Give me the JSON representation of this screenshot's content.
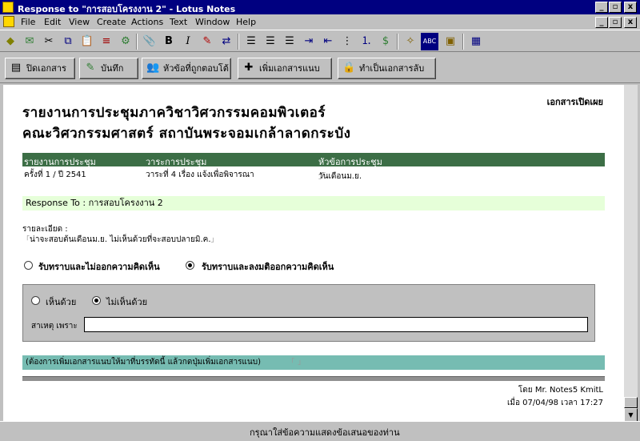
{
  "window": {
    "title": "Response to \"การสอบโครงงาน 2\" - Lotus Notes",
    "controls": [
      "_",
      "▫",
      "x"
    ]
  },
  "menu": [
    "File",
    "Edit",
    "View",
    "Create",
    "Actions",
    "Text",
    "Window",
    "Help"
  ],
  "toolbar_icons": [
    "navigator-icon",
    "mail-icon",
    "cut-icon",
    "copy-icon",
    "paste-icon",
    "stack-icon",
    "properties-icon",
    "attach-icon",
    "bold-icon",
    "italic-icon",
    "highlighter-icon",
    "permanent-pen-icon",
    "align-left-icon",
    "align-center-icon",
    "align-right-icon",
    "indent-icon",
    "outdent-icon",
    "bullets-icon",
    "numbers-icon",
    "text-style-icon",
    "flashlight-icon",
    "spell-check-icon",
    "form-icon",
    "table-icon"
  ],
  "actions": [
    {
      "label": "ปิดเอกสาร",
      "icon": "close-document-icon"
    },
    {
      "label": "บันทึก",
      "icon": "save-icon"
    },
    {
      "label": "หัวข้อที่ถูกตอบโต้",
      "icon": "topic-icon"
    },
    {
      "label": "เพิ่มเอกสารแนบ",
      "icon": "add-attachment-icon"
    },
    {
      "label": "ทำเป็นเอกสารลับ",
      "icon": "lock-icon"
    }
  ],
  "document": {
    "public_label": "เอกสารเปิดเผย",
    "heading_line1": "รายงานการประชุมภาควิชาวิศวกรรมคอมพิวเตอร์",
    "heading_line2": "คณะวิศวกรรมศาสตร์ สถาบันพระจอมเกล้าลาดกระบัง",
    "meeting_header": {
      "report": "รายงานการประชุม",
      "agenda": "วาระการประชุม",
      "topic": "หัวข้อการประชุม"
    },
    "meeting_values": {
      "report": "ครั้งที่ 1 / ปี 2541",
      "agenda": "วาระที่ 4  เรื่อง แจ้งเพื่อพิจารณา",
      "topic": "วันเดือนม.ย."
    },
    "response_to": "Response To : การสอบโครงงาน 2",
    "detail_label": "รายละเอียด :",
    "detail_text": "น่าจะสอบต้นเดือนม.ย. ไม่เห็นด้วยที่จะสอบปลายมิ.ค.",
    "ack_options": [
      {
        "label": "รับทราบและไม่ออกความคิดเห็น",
        "checked": false
      },
      {
        "label": "รับทราบและลงมติออกความคิดเห็น",
        "checked": true
      }
    ],
    "opinion_options": [
      {
        "label": "เห็นด้วย",
        "checked": false
      },
      {
        "label": "ไม่เห็นด้วย",
        "checked": true
      }
    ],
    "reason_label": "สาเหตุ เพราะ",
    "reason_value": "",
    "attach_text": "(ต้องการเพิ่มเอกสารแนบให้มาที่บรรทัดนี้ แล้วกดปุ่มเพิ่มเอกสารแนบ)",
    "author": "โดย Mr. Notes5 KmitL",
    "date": "เมื่อ 07/04/98 เวลา 17:27"
  },
  "status": "กรุณาใส่ข้อความแสดงข้อเสนอของท่าน",
  "colors": {
    "titlebar": "#000080",
    "meeting_header_bg": "#3c6e46",
    "response_bg": "#e6ffd9",
    "attach_bg": "#76bcb2"
  }
}
